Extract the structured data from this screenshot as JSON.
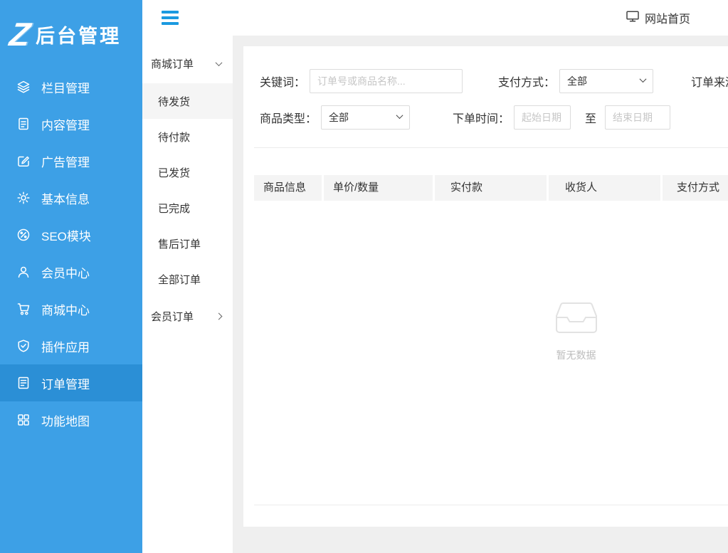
{
  "colors": {
    "sidebar_bg": "#3da0e6",
    "sidebar_active_bg": "#2b8fd6",
    "accent_blue": "#1b9ae0",
    "main_bg": "#efefef",
    "table_header_bg": "#f4f4f4"
  },
  "brand": {
    "logo_letter": "Z",
    "title": "后台管理"
  },
  "topbar": {
    "home_label": "网站首页"
  },
  "sidebar": {
    "items": [
      {
        "label": "栏目管理",
        "icon": "layers-icon",
        "active": false
      },
      {
        "label": "内容管理",
        "icon": "document-icon",
        "active": false
      },
      {
        "label": "广告管理",
        "icon": "ad-edit-icon",
        "active": false
      },
      {
        "label": "基本信息",
        "icon": "gear-icon",
        "active": false
      },
      {
        "label": "SEO模块",
        "icon": "seo-link-icon",
        "active": false
      },
      {
        "label": "会员中心",
        "icon": "user-icon",
        "active": false
      },
      {
        "label": "商城中心",
        "icon": "cart-icon",
        "active": false
      },
      {
        "label": "插件应用",
        "icon": "shield-check-icon",
        "active": false
      },
      {
        "label": "订单管理",
        "icon": "order-list-icon",
        "active": true
      },
      {
        "label": "功能地图",
        "icon": "grid-icon",
        "active": false
      }
    ]
  },
  "submenu": {
    "group1": {
      "label": "商城订单",
      "expanded": true
    },
    "group1_items": [
      {
        "label": "待发货",
        "active": true
      },
      {
        "label": "待付款",
        "active": false
      },
      {
        "label": "已发货",
        "active": false
      },
      {
        "label": "已完成",
        "active": false
      },
      {
        "label": "售后订单",
        "active": false
      },
      {
        "label": "全部订单",
        "active": false
      }
    ],
    "group2": {
      "label": "会员订单",
      "expanded": false
    }
  },
  "filters": {
    "keyword_label": "关键词：",
    "keyword_placeholder": "订单号或商品名称...",
    "payment_label": "支付方式：",
    "payment_value": "全部",
    "order_source_label": "订单来源：",
    "type_label": "商品类型：",
    "type_value": "全部",
    "time_label": "下单时间：",
    "date_start_placeholder": "起始日期",
    "to_label": "至",
    "date_end_placeholder": "结束日期"
  },
  "table": {
    "headers": [
      "商品信息",
      "单价/数量",
      "实付款",
      "收货人",
      "支付方式"
    ]
  },
  "empty_state": {
    "text": "暂无数据"
  }
}
